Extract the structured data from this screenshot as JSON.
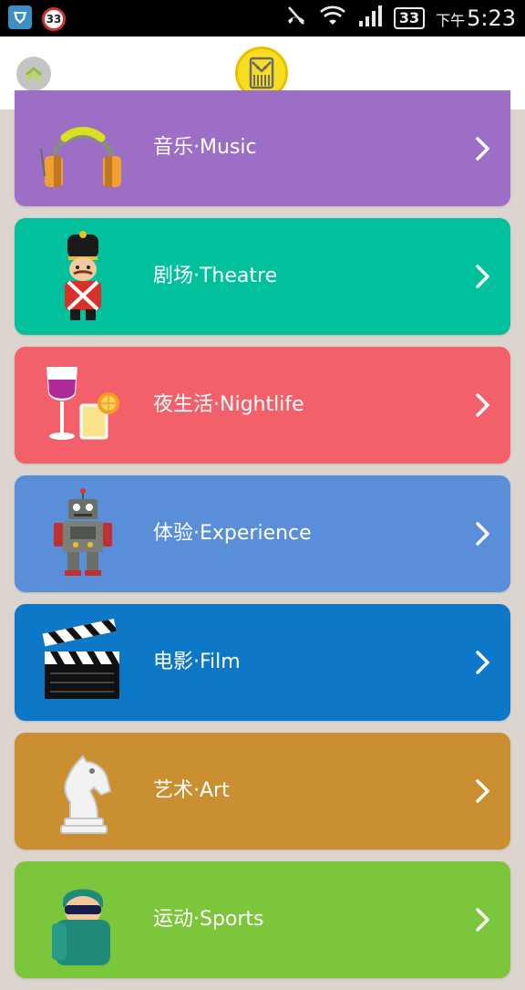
{
  "status_bar": {
    "notification_count": "33",
    "battery_level": "33",
    "time_prefix": "下午",
    "time": "5:23"
  },
  "header": {
    "collapse_icon": "double-chevron-up-icon",
    "logo_icon": "theatre-logo-icon"
  },
  "categories": [
    {
      "label": "音乐·Music",
      "color": "#9c6ec5",
      "icon": "headphones-icon"
    },
    {
      "label": "剧场·Theatre",
      "color": "#00c19b",
      "icon": "toy-soldier-icon"
    },
    {
      "label": "夜生活·Nightlife",
      "color": "#f4606a",
      "icon": "drinks-icon"
    },
    {
      "label": "体验·Experience",
      "color": "#5b8ed9",
      "icon": "robot-icon"
    },
    {
      "label": "电影·Film",
      "color": "#0e78c8",
      "icon": "clapperboard-icon"
    },
    {
      "label": "艺术·Art",
      "color": "#c98f30",
      "icon": "chess-knight-icon"
    },
    {
      "label": "运动·Sports",
      "color": "#7cc63b",
      "icon": "athlete-icon"
    }
  ]
}
